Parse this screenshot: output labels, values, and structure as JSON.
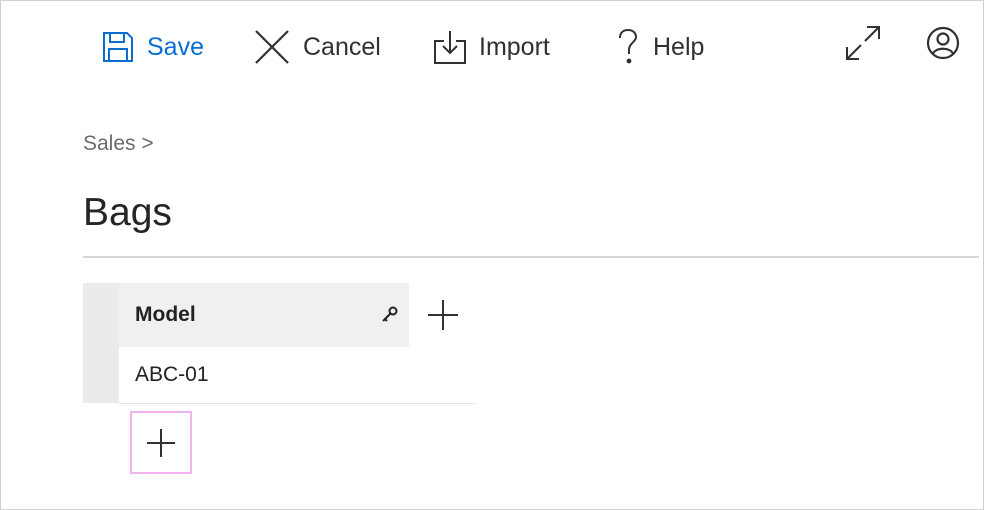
{
  "toolbar": {
    "save_label": "Save",
    "cancel_label": "Cancel",
    "import_label": "Import",
    "help_label": "Help",
    "icons": [
      "save-icon",
      "close-icon",
      "import-icon",
      "help-icon",
      "expand-icon",
      "account-icon"
    ]
  },
  "breadcrumb": {
    "text": "Sales >"
  },
  "page": {
    "title": "Bags"
  },
  "table": {
    "columns": [
      {
        "label": "Model",
        "is_key": true
      }
    ],
    "rows": [
      [
        "ABC-01"
      ]
    ]
  },
  "colors": {
    "accent": "#0a6ed1",
    "highlight_border": "#f0b4f0",
    "header_bg": "#f0f0f0",
    "gutter_bg": "#ebebeb"
  }
}
